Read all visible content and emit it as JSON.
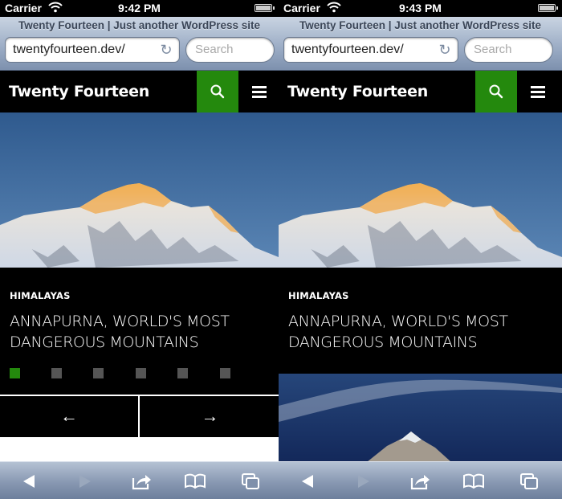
{
  "phones": [
    {
      "status": {
        "carrier": "Carrier",
        "time": "9:42 PM"
      },
      "browser": {
        "page_title": "Twenty Fourteen | Just another WordPress site",
        "url": "twentyfourteen.dev/",
        "search_placeholder": "Search"
      },
      "site": {
        "title": "Twenty Fourteen"
      },
      "featured": {
        "category": "HIMALAYAS",
        "headline": "ANNAPURNA, WORLD'S MOST DANGEROUS MOUNTAINS",
        "slider_total": 6,
        "slider_active": 1
      },
      "slider_nav": {
        "prev": "←",
        "next": "→"
      }
    },
    {
      "status": {
        "carrier": "Carrier",
        "time": "9:43 PM"
      },
      "browser": {
        "page_title": "Twenty Fourteen | Just another WordPress site",
        "url": "twentyfourteen.dev/",
        "search_placeholder": "Search"
      },
      "site": {
        "title": "Twenty Fourteen"
      },
      "featured": {
        "category": "HIMALAYAS",
        "headline": "ANNAPURNA, WORLD'S MOST DANGEROUS MOUNTAINS"
      }
    }
  ],
  "colors": {
    "accent": "#24890d",
    "header_bg": "#000000",
    "dot_inactive": "#555555"
  },
  "toolbar_icons": [
    "back-icon",
    "forward-icon",
    "share-icon",
    "bookmarks-icon",
    "tabs-icon"
  ]
}
